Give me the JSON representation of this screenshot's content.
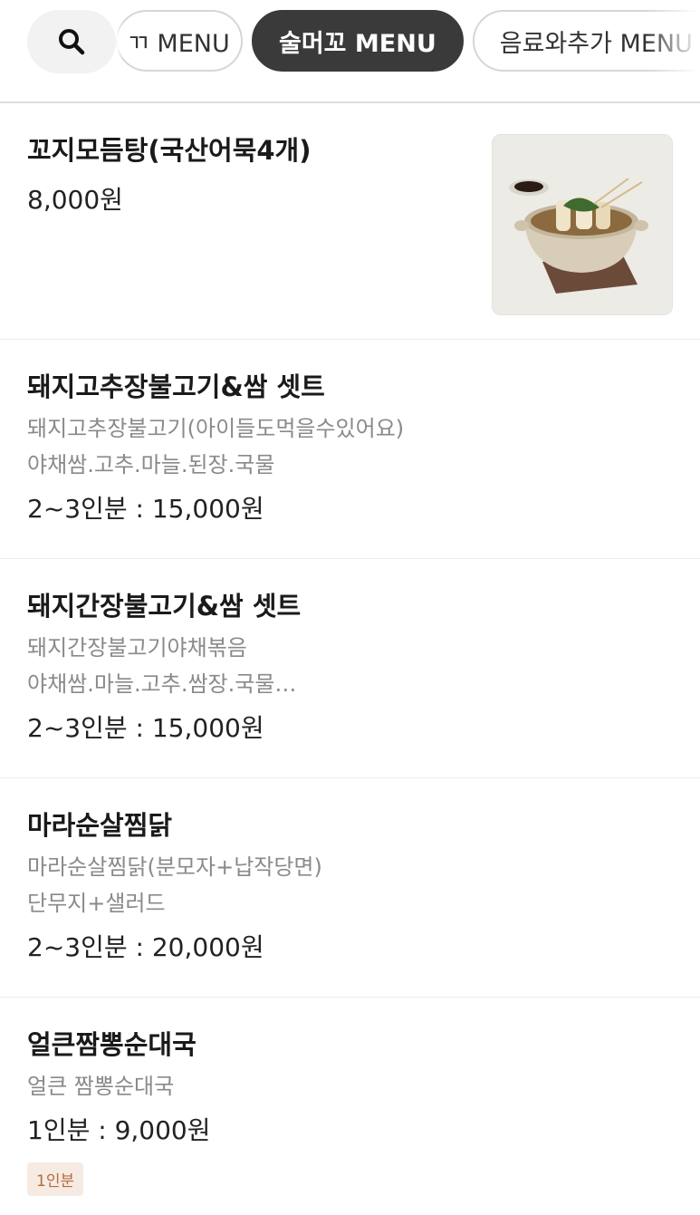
{
  "header": {
    "tabs": [
      {
        "label": "ㄲ MENU"
      },
      {
        "label": "술머꼬 MENU"
      },
      {
        "label": "음료와추가 MENU"
      }
    ]
  },
  "menu": [
    {
      "name": "꼬지모듬탕(국산어묵4개)",
      "price": "8,000원"
    },
    {
      "name": "돼지고추장불고기&쌈 셋트",
      "desc1": "돼지고추장불고기(아이들도먹을수있어요)",
      "desc2": "야채쌈.고추.마늘.된장.국물",
      "price": "2~3인분 : 15,000원"
    },
    {
      "name": "돼지간장불고기&쌈 셋트",
      "desc1": "돼지간장불고기야채볶음",
      "desc2": "야채쌈.마늘.고추.쌈장.국물…",
      "price": "2~3인분 : 15,000원"
    },
    {
      "name": "마라순살찜닭",
      "desc1": "마라순살찜닭(분모자+납작당면)",
      "desc2": "단무지+샐러드",
      "price": "2~3인분 : 20,000원"
    },
    {
      "name": "얼큰짬뽕순대국",
      "desc1": "얼큰 짬뽕순대국",
      "price": "1인분 : 9,000원",
      "badge": "1인분"
    }
  ]
}
